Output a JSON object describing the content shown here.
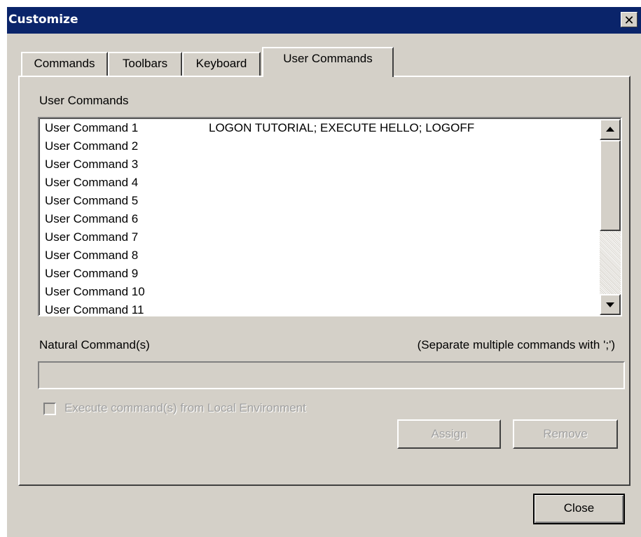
{
  "window": {
    "title": "Customize",
    "close_glyph": "✕"
  },
  "tabs": [
    {
      "label": "Commands",
      "active": false
    },
    {
      "label": "Toolbars",
      "active": false
    },
    {
      "label": "Keyboard",
      "active": false
    },
    {
      "label": "User Commands",
      "active": true
    }
  ],
  "panel": {
    "list_label": "User Commands",
    "commands": [
      {
        "name": "User Command 1",
        "value": "LOGON TUTORIAL; EXECUTE HELLO; LOGOFF"
      },
      {
        "name": "User Command 2",
        "value": ""
      },
      {
        "name": "User Command 3",
        "value": ""
      },
      {
        "name": "User Command 4",
        "value": ""
      },
      {
        "name": "User Command 5",
        "value": ""
      },
      {
        "name": "User Command 6",
        "value": ""
      },
      {
        "name": "User Command 7",
        "value": ""
      },
      {
        "name": "User Command 8",
        "value": ""
      },
      {
        "name": "User Command 9",
        "value": ""
      },
      {
        "name": "User Command 10",
        "value": ""
      },
      {
        "name": "User Command 11",
        "value": ""
      }
    ],
    "natural_label": "Natural Command(s)",
    "separator_hint": "(Separate multiple commands with ';')",
    "natural_value": "",
    "checkbox_label": "Execute command(s) from Local Environment",
    "checkbox_checked": false,
    "assign_label": "Assign",
    "remove_label": "Remove"
  },
  "footer": {
    "close_label": "Close"
  },
  "colors": {
    "titlebar": "#0a246a",
    "dialog_face": "#d4d0c8",
    "disabled_text": "#a0a0a0"
  },
  "icons": {
    "scroll_up": "arrow-up-icon",
    "scroll_down": "arrow-down-icon",
    "close": "close-icon"
  }
}
